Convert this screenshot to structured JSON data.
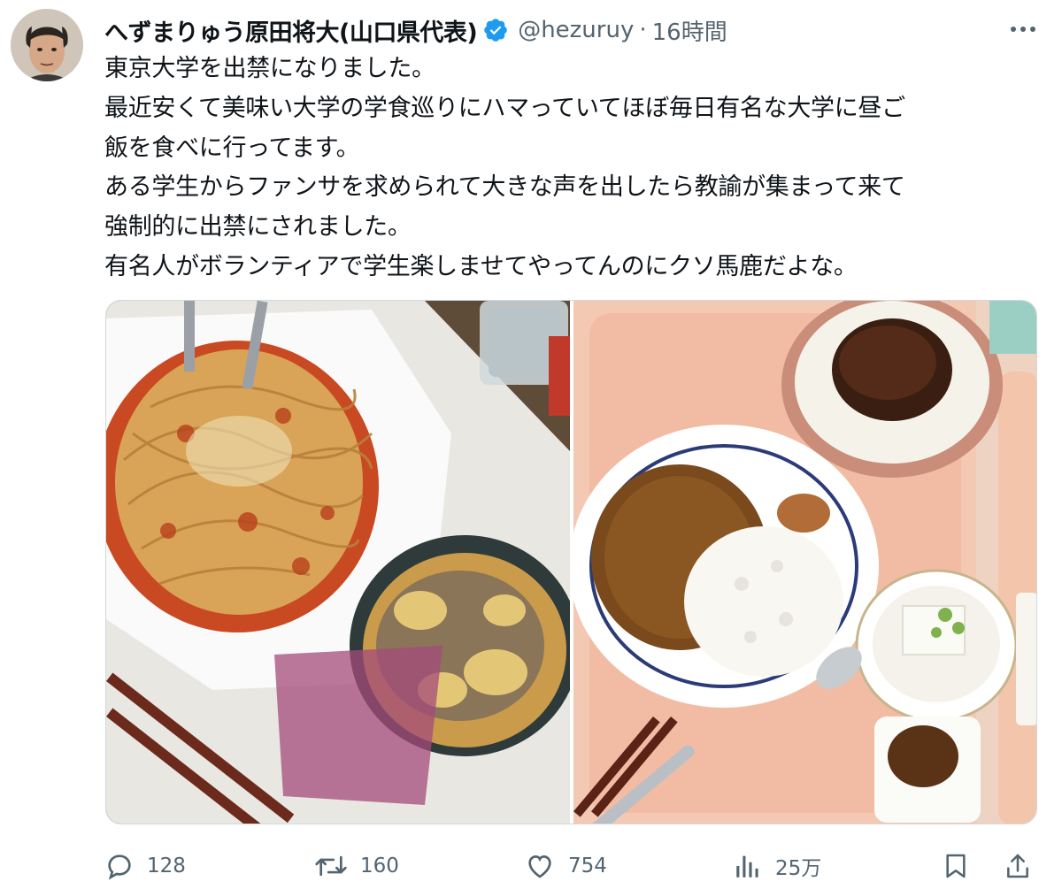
{
  "author": {
    "display_name": "へずまりゅう原田将大(山口県代表)",
    "handle": "@hezuruy",
    "separator": "·",
    "time": "16時間",
    "verified": true
  },
  "tweet": {
    "lines": [
      "東京大学を出禁になりました。",
      "最近安くて美味い大学の学食巡りにハマっていてほぼ毎日有名な大学に昼ご",
      "飯を食べに行ってます。",
      "ある学生からファンサを求められて大きな声を出したら教諭が集まって来て",
      "強制的に出禁にされました。",
      "有名人がボランティアで学生楽しませてやってんのにクソ馬鹿だよな。"
    ]
  },
  "media": {
    "photos": [
      {
        "subject": "spaghetti and katsudon on tray"
      },
      {
        "subject": "curry rice, hamburg steak bowl, tofu on tray"
      }
    ]
  },
  "actions": {
    "reply_count": "128",
    "retweet_count": "160",
    "like_count": "754",
    "view_count": "25万"
  },
  "colors": {
    "text": "#0f1419",
    "secondary": "#536471",
    "verified": "#1d9bf0",
    "border": "#cfd9de"
  }
}
